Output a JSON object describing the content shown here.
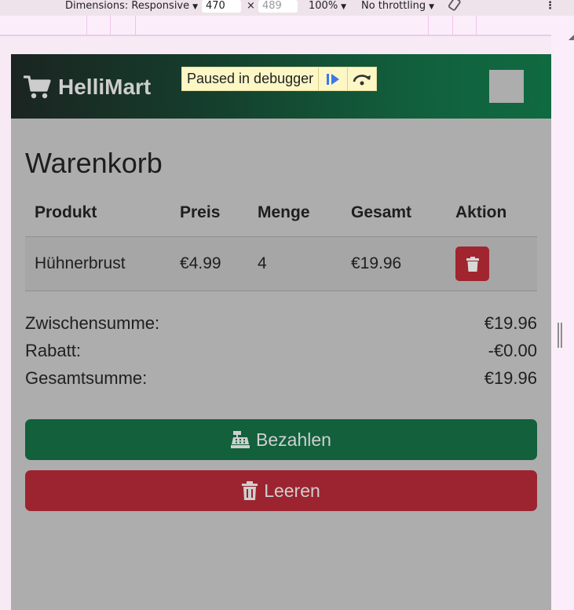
{
  "devtools": {
    "dimensions_label": "Dimensions: Responsive",
    "width_value": "470",
    "times": "×",
    "height_placeholder": "489",
    "zoom": "100%",
    "throttling": "No throttling",
    "more_icon": "⋮"
  },
  "debugger": {
    "label": "Paused in debugger"
  },
  "navbar": {
    "brand": "HelliMart"
  },
  "cart": {
    "title": "Warenkorb",
    "columns": [
      "Produkt",
      "Preis",
      "Menge",
      "Gesamt",
      "Aktion"
    ],
    "rows": [
      {
        "product": "Hühnerbrust",
        "price": "€4.99",
        "qty": "4",
        "total": "€19.96"
      }
    ]
  },
  "summary": {
    "subtotal_label": "Zwischensumme:",
    "subtotal_value": "€19.96",
    "discount_label": "Rabatt:",
    "discount_value": "-€0.00",
    "total_label": "Gesamtsumme:",
    "total_value": "€19.96"
  },
  "buttons": {
    "pay": "Bezahlen",
    "clear": "Leeren"
  },
  "colors": {
    "nav_start": "#1b2421",
    "nav_end": "#0f6a41",
    "pay": "#12603c",
    "clear": "#9c2430",
    "delete": "#a1252e",
    "page_bg": "#adadad"
  }
}
